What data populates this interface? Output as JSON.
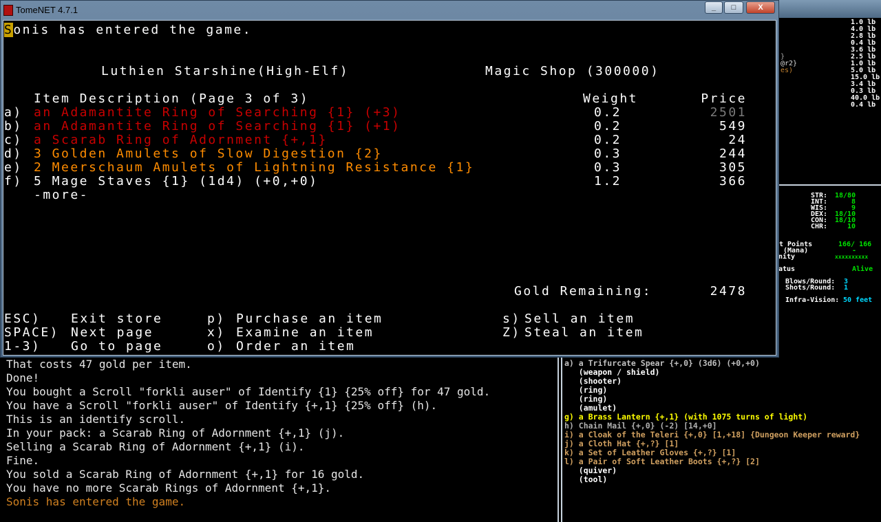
{
  "window": {
    "title": "TomeNET 4.7.1",
    "minimize": "_",
    "maximize": "□",
    "close": "X"
  },
  "store": {
    "message": "Sonis has entered the game.",
    "player": "Luthien Starshine(High-Elf)",
    "shop": "Magic Shop (300000)",
    "header_desc": "Item Description (Page 3 of 3)",
    "header_weight": "Weight",
    "header_price": "Price",
    "items": [
      {
        "key": "a)",
        "desc": "an Adamantite Ring of Searching {1} (+3)",
        "weight": "0.2",
        "price": "2501",
        "color": "#c80000",
        "price_color": "#7a7a7a"
      },
      {
        "key": "b)",
        "desc": "an Adamantite Ring of Searching {1} (+1)",
        "weight": "0.2",
        "price": "549",
        "color": "#c80000"
      },
      {
        "key": "c)",
        "desc": "a Scarab Ring of Adornment {+,1}",
        "weight": "0.2",
        "price": "24",
        "color": "#c80000"
      },
      {
        "key": "d)",
        "desc": "3 Golden Amulets of Slow Digestion {2}",
        "weight": "0.3",
        "price": "244",
        "color": "#ff8c00"
      },
      {
        "key": "e)",
        "desc": "2 Meerschaum Amulets of Lightning Resistance {1}",
        "weight": "0.3",
        "price": "305",
        "color": "#ff8c00"
      },
      {
        "key": "f)",
        "desc": "5 Mage Staves {1} (1d4) (+0,+0)",
        "weight": "1.2",
        "price": "366",
        "color": "#ffffff"
      }
    ],
    "more": "-more-",
    "gold_label": "Gold Remaining:",
    "gold_value": "2478",
    "commands": [
      {
        "key": "ESC)",
        "label": "Exit store"
      },
      {
        "key": "SPACE)",
        "label": "Next page"
      },
      {
        "key": "1-3)",
        "label": "Go to page"
      },
      {
        "key": "p)",
        "label": "Purchase an item"
      },
      {
        "key": "x)",
        "label": "Examine an item"
      },
      {
        "key": "o)",
        "label": "Order an item"
      },
      {
        "key": "s)",
        "label": "Sell an item"
      },
      {
        "key": "Z)",
        "label": "Steal an item"
      }
    ]
  },
  "messages": [
    "That costs 47 gold per item.",
    "Done!",
    "You bought a Scroll \"forkli auser\" of Identify {1} {25% off} for 47 gold.",
    "You have a Scroll \"forkli auser\" of Identify {+,1} {25% off} (h).",
    "This is an identify scroll.",
    "In your pack: a Scarab Ring of Adornment {+,1} (j).",
    "Selling a Scarab Ring of Adornment {+,1} (i).",
    "Fine.",
    "You sold a Scarab Ring of Adornment {+,1} for 16 gold.",
    "You have no more Scarab Rings of Adornment {+,1}.",
    "Sonis has entered the game."
  ],
  "equipment": [
    {
      "text": "a) a Trifurcate Spear {+,0} (3d6) (+0,+0)",
      "color": "#c0c0c0"
    },
    {
      "text": "   (weapon / shield)",
      "color": "#ffffff"
    },
    {
      "text": "   (shooter)",
      "color": "#ffffff"
    },
    {
      "text": "   (ring)",
      "color": "#ffffff"
    },
    {
      "text": "   (ring)",
      "color": "#ffffff"
    },
    {
      "text": "   (amulet)",
      "color": "#ffffff"
    },
    {
      "text": "g) a Brass Lantern {+,1} (with 1075 turns of light)",
      "color": "#ffff00"
    },
    {
      "text": "h) Chain Mail {+,0} (-2) [14,+0]",
      "color": "#b0b0b0"
    },
    {
      "text": "i) a Cloak of the Teleri {+,0} [1,+18] {Dungeon Keeper reward}",
      "color": "#d0a060"
    },
    {
      "text": "j) a Cloth Hat {+,?} [1]",
      "color": "#d0a060"
    },
    {
      "text": "k) a Set of Leather Gloves {+,?} [1]",
      "color": "#d0a060"
    },
    {
      "text": "l) a Pair of Soft Leather Boots {+,?} [2]",
      "color": "#d0a060"
    },
    {
      "text": "   (quiver)",
      "color": "#ffffff"
    },
    {
      "text": "   (tool)",
      "color": "#ffffff"
    }
  ],
  "background_inventory": {
    "weights": [
      "1.0 lb",
      "4.0 lb",
      "2.8 lb",
      "0.4 lb",
      "3.6 lb",
      "2.5 lb",
      "1.0 lb",
      "5.0 lb",
      "15.0 lb",
      "3.4 lb",
      "0.3 lb",
      "40.0 lb",
      "0.4 lb"
    ],
    "fragments": [
      "}",
      "@r2}",
      "es)"
    ]
  },
  "character": {
    "stats": [
      {
        "name": "STR:",
        "value": "18/80"
      },
      {
        "name": "INT:",
        "value": "8"
      },
      {
        "name": "WIS:",
        "value": "9"
      },
      {
        "name": "DEX:",
        "value": "18/10"
      },
      {
        "name": "CON:",
        "value": "18/10"
      },
      {
        "name": "CHR:",
        "value": "10"
      }
    ],
    "hit_points_label": "t Points",
    "hit_points": "166/ 166",
    "mana_label": "(Mana)",
    "mana": "-",
    "sanity_label": "nity",
    "sanity": "xxxxxxxxxx",
    "status_label": "atus",
    "status": "Alive",
    "blows_label": "Blows/Round:",
    "blows": "3",
    "shots_label": "Shots/Round:",
    "shots": "1",
    "infra_label": "Infra-Vision:",
    "infra": "50 feet"
  },
  "colors": {
    "green": "#00e000",
    "cyan": "#00d8ff",
    "red_item": "#c80000",
    "orange_item": "#ff8c00",
    "message_orange": "#d08020"
  }
}
